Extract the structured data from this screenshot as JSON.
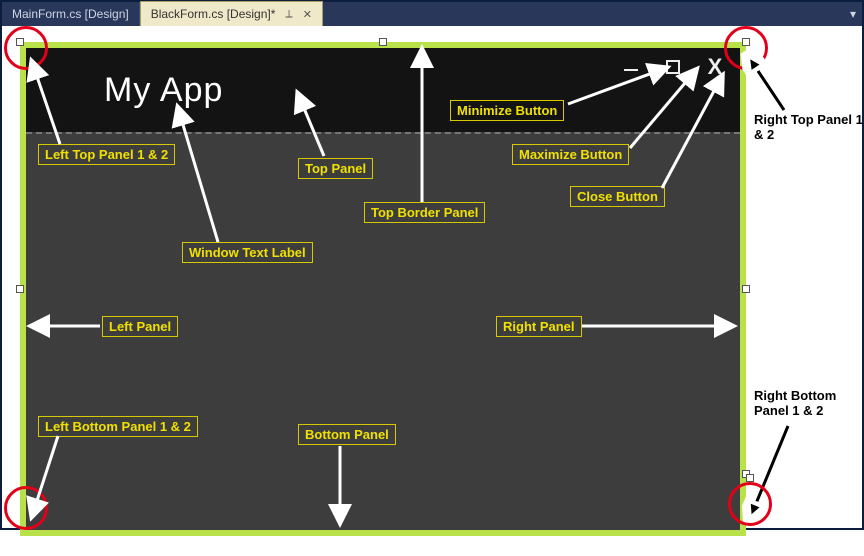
{
  "ide": {
    "tabs": [
      {
        "label": "MainForm.cs [Design]"
      },
      {
        "label": "BlackForm.cs [Design]*",
        "pin": "⟂",
        "close": "✕"
      }
    ],
    "menu_glyph": "▾"
  },
  "form": {
    "title": "My App",
    "buttons": {
      "minimize_glyph": "—",
      "maximize_glyph": "□",
      "close_glyph": "X"
    }
  },
  "annotations": {
    "left_top": "Left Top Panel 1 & 2",
    "top_panel": "Top Panel",
    "top_border_panel": "Top Border Panel",
    "window_text_label": "Window Text Label",
    "minimize_btn": "Minimize Button",
    "maximize_btn": "Maximize Button",
    "close_btn": "Close Button",
    "left_panel": "Left Panel",
    "right_panel": "Right Panel",
    "left_bottom": "Left Bottom Panel 1 & 2",
    "bottom_panel": "Bottom Panel",
    "right_top_side": "Right Top Panel 1 & 2",
    "right_bottom_side": "Right Bottom Panel 1 & 2"
  }
}
